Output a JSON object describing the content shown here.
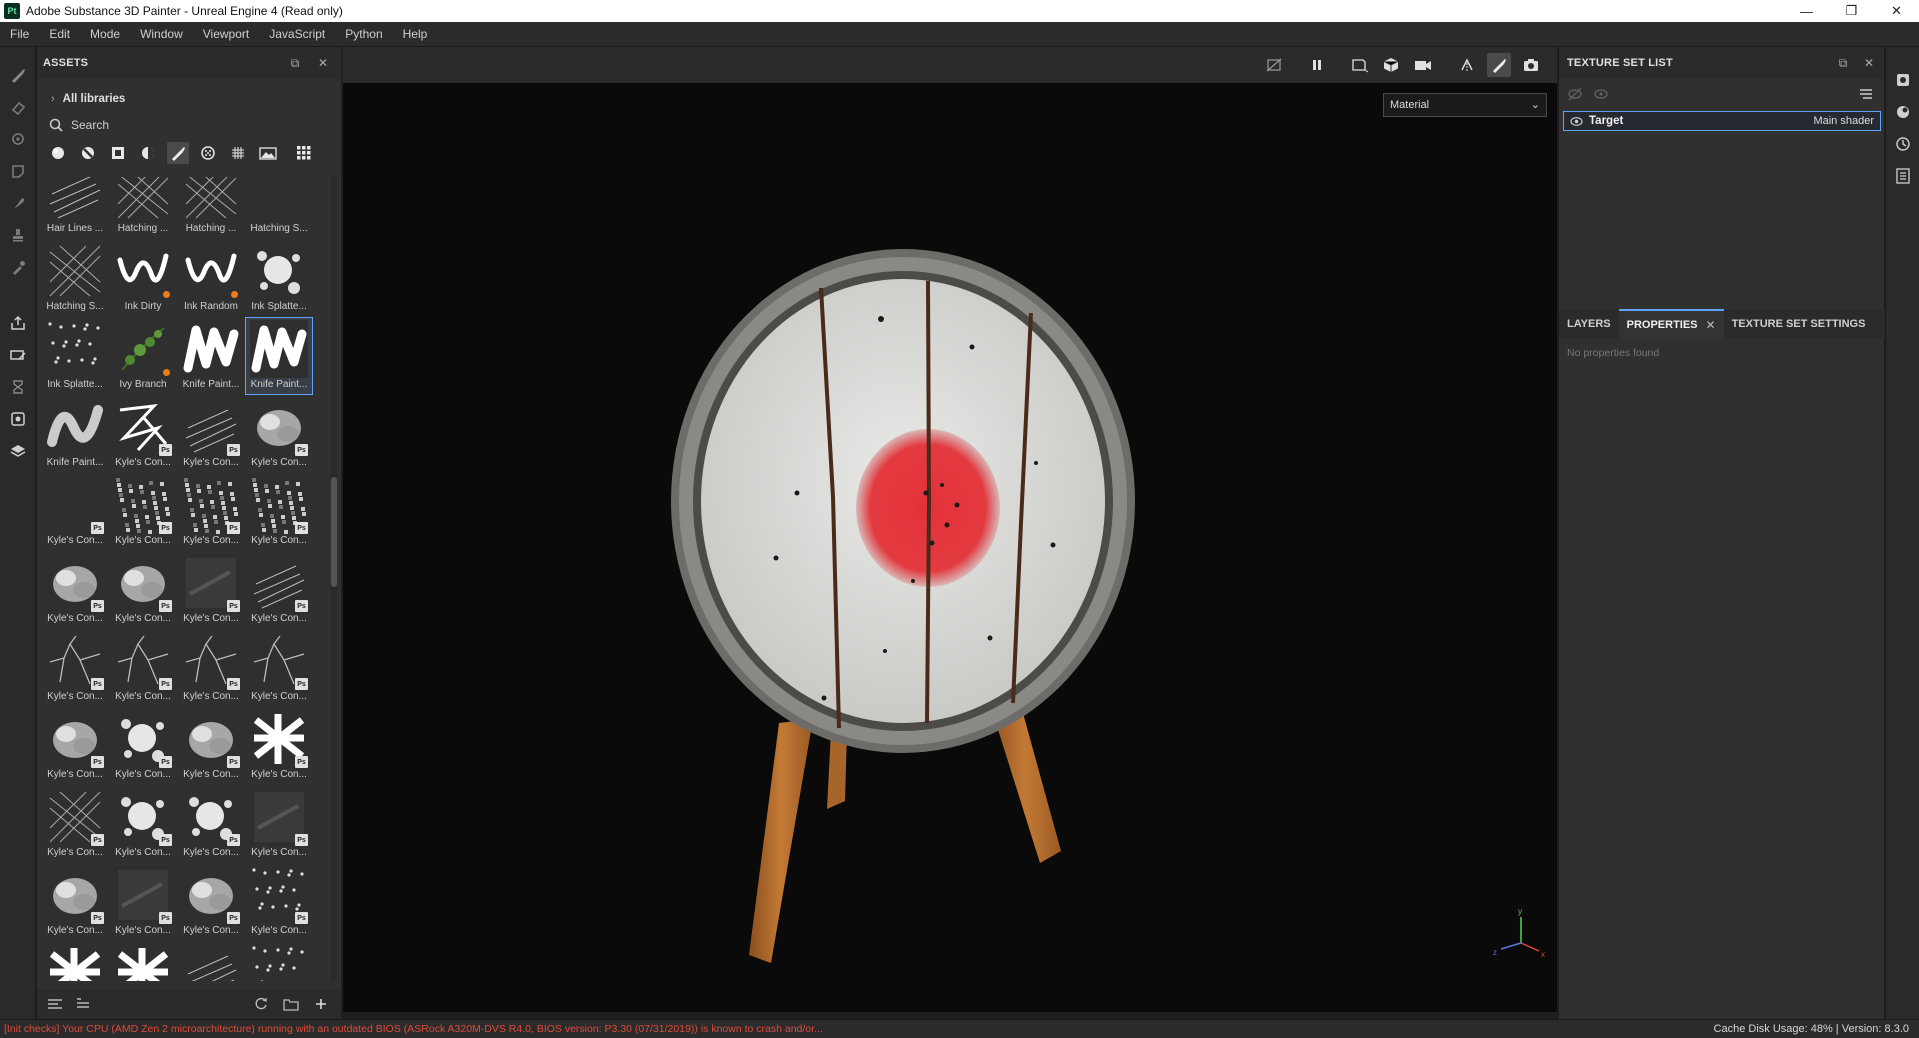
{
  "window": {
    "title": "Adobe Substance 3D Painter - Unreal Engine 4 (Read only)",
    "app_icon_text": "Pt",
    "minimize_symbol": "—",
    "maximize_symbol": "❐",
    "close_symbol": "✕"
  },
  "menubar": [
    "File",
    "Edit",
    "Mode",
    "Window",
    "Viewport",
    "JavaScript",
    "Python",
    "Help"
  ],
  "tool_rail": {
    "icons": [
      "paint-brush-icon",
      "eraser-icon",
      "projection-icon",
      "geometry-mask-icon",
      "smudge-icon",
      "clone-stamp-icon",
      "color-picker-icon",
      "bake-icon",
      "paint-mode-icon",
      "texture-set-icon",
      "uv-icon",
      "export-icon"
    ]
  },
  "assets_panel": {
    "title": "ASSETS",
    "libraries_label": "All libraries",
    "search_placeholder": "Search",
    "filters": [
      "materials-filter",
      "smart-materials-filter",
      "masks-filter",
      "smart-masks-filter",
      "brushes-filter",
      "particles-filter",
      "textures-filter",
      "environments-filter",
      "grid-view"
    ],
    "active_filter": "brushes-filter",
    "items": [
      {
        "label": "Hair Lines ...",
        "ps": false,
        "dot": false,
        "style": "lines"
      },
      {
        "label": "Hatching ...",
        "ps": false,
        "dot": false,
        "style": "hatch"
      },
      {
        "label": "Hatching ...",
        "ps": false,
        "dot": false,
        "style": "hatch"
      },
      {
        "label": "Hatching S...",
        "ps": false,
        "dot": false,
        "style": "blank"
      },
      {
        "label": "Hatching S...",
        "ps": false,
        "dot": false,
        "style": "hatch"
      },
      {
        "label": "Ink Dirty",
        "ps": false,
        "dot": true,
        "style": "stroke"
      },
      {
        "label": "Ink Random",
        "ps": false,
        "dot": true,
        "style": "stroke"
      },
      {
        "label": "Ink Splatte...",
        "ps": false,
        "dot": false,
        "style": "splat"
      },
      {
        "label": "Ink Splatte...",
        "ps": false,
        "dot": false,
        "style": "dots"
      },
      {
        "label": "Ivy Branch",
        "ps": false,
        "dot": true,
        "style": "ivy"
      },
      {
        "label": "Knife Paint...",
        "ps": false,
        "dot": false,
        "style": "knife"
      },
      {
        "label": "Knife Paint...",
        "ps": false,
        "dot": false,
        "style": "knife",
        "selected": true
      },
      {
        "label": "Knife Paint...",
        "ps": false,
        "dot": false,
        "style": "knife-soft"
      },
      {
        "label": "Kyle's Con...",
        "ps": true,
        "dot": false,
        "style": "zigzag"
      },
      {
        "label": "Kyle's Con...",
        "ps": true,
        "dot": false,
        "style": "lines"
      },
      {
        "label": "Kyle's Con...",
        "ps": true,
        "dot": false,
        "style": "cloud"
      },
      {
        "label": "Kyle's Con...",
        "ps": true,
        "dot": false,
        "style": "squiggle"
      },
      {
        "label": "Kyle's Con...",
        "ps": true,
        "dot": false,
        "style": "noise"
      },
      {
        "label": "Kyle's Con...",
        "ps": true,
        "dot": false,
        "style": "noise"
      },
      {
        "label": "Kyle's Con...",
        "ps": true,
        "dot": false,
        "style": "noise"
      },
      {
        "label": "Kyle's Con...",
        "ps": true,
        "dot": false,
        "style": "cloud"
      },
      {
        "label": "Kyle's Con...",
        "ps": true,
        "dot": false,
        "style": "cloud"
      },
      {
        "label": "Kyle's Con...",
        "ps": true,
        "dot": false,
        "style": "dark"
      },
      {
        "label": "Kyle's Con...",
        "ps": true,
        "dot": false,
        "style": "lines"
      },
      {
        "label": "Kyle's Con...",
        "ps": true,
        "dot": false,
        "style": "crack"
      },
      {
        "label": "Kyle's Con...",
        "ps": true,
        "dot": false,
        "style": "crack"
      },
      {
        "label": "Kyle's Con...",
        "ps": true,
        "dot": false,
        "style": "crack"
      },
      {
        "label": "Kyle's Con...",
        "ps": true,
        "dot": false,
        "style": "crack"
      },
      {
        "label": "Kyle's Con...",
        "ps": true,
        "dot": false,
        "style": "cloud"
      },
      {
        "label": "Kyle's Con...",
        "ps": true,
        "dot": false,
        "style": "splat"
      },
      {
        "label": "Kyle's Con...",
        "ps": true,
        "dot": false,
        "style": "cloud"
      },
      {
        "label": "Kyle's Con...",
        "ps": true,
        "dot": false,
        "style": "bright"
      },
      {
        "label": "Kyle's Con...",
        "ps": true,
        "dot": false,
        "style": "hatch"
      },
      {
        "label": "Kyle's Con...",
        "ps": true,
        "dot": false,
        "style": "splat"
      },
      {
        "label": "Kyle's Con...",
        "ps": true,
        "dot": false,
        "style": "splat"
      },
      {
        "label": "Kyle's Con...",
        "ps": true,
        "dot": false,
        "style": "dark"
      },
      {
        "label": "Kyle's Con...",
        "ps": true,
        "dot": false,
        "style": "cloud"
      },
      {
        "label": "Kyle's Con...",
        "ps": true,
        "dot": false,
        "style": "dark"
      },
      {
        "label": "Kyle's Con...",
        "ps": true,
        "dot": false,
        "style": "cloud"
      },
      {
        "label": "Kyle's Con...",
        "ps": true,
        "dot": false,
        "style": "dots"
      },
      {
        "label": "Kyle's Con...",
        "ps": true,
        "dot": false,
        "style": "bright"
      },
      {
        "label": "Kyle's Con...",
        "ps": true,
        "dot": false,
        "style": "bright"
      },
      {
        "label": "Kyle's Con...",
        "ps": true,
        "dot": false,
        "style": "lines"
      },
      {
        "label": "Kyle's Con...",
        "ps": true,
        "dot": false,
        "style": "dots"
      }
    ]
  },
  "viewport": {
    "material_mode": "Material",
    "caret": "⌄",
    "toolbar_icons": [
      "hide-ui-icon",
      "pause-icon",
      "viewport-2d-icon",
      "viewport-3d-icon",
      "camera-icon",
      "symmetry-icon",
      "brush-icon",
      "screenshot-icon"
    ],
    "axis_labels": {
      "x": "x",
      "y": "y",
      "z": "z"
    }
  },
  "texture_set_list": {
    "title": "TEXTURE SET LIST",
    "set_name": "Target",
    "shader": "Main shader"
  },
  "properties_tabs": {
    "tabs": [
      {
        "label": "LAYERS",
        "active": false,
        "closable": false
      },
      {
        "label": "PROPERTIES",
        "active": true,
        "closable": true
      },
      {
        "label": "TEXTURE SET SETTINGS",
        "active": false,
        "closable": false
      }
    ],
    "close_symbol": "✕",
    "empty_message": "No properties found"
  },
  "right_rail": {
    "icons": [
      "display-settings-icon",
      "shader-settings-icon",
      "history-icon",
      "log-icon"
    ]
  },
  "statusbar": {
    "message": "[Init checks] Your CPU (AMD Zen 2 microarchitecture) running with an outdated BIOS (ASRock A320M-DVS R4.0, BIOS version: P3.30 (07/31/2019)) is known to crash and/or...",
    "right": "Cache Disk Usage:   48% | Version: 8.3.0"
  },
  "colors": {
    "accent": "#5ea3ff",
    "error": "#e04b3a",
    "panel": "#303030",
    "viewport_bg": "#0a0a0a"
  }
}
